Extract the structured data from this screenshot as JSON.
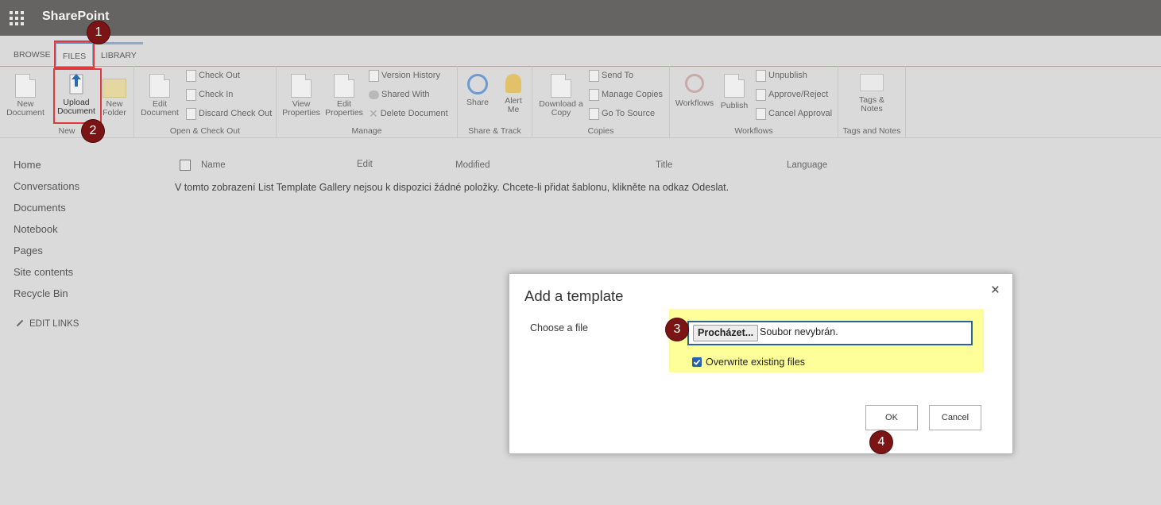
{
  "suite": {
    "brand": "SharePoint",
    "waffle_icon": "app-launcher-icon"
  },
  "ribbon": {
    "tabs": [
      {
        "label": "BROWSE"
      },
      {
        "label": "FILES"
      },
      {
        "label": "LIBRARY"
      }
    ],
    "groups": {
      "new": {
        "label": "New",
        "new_document": "New\nDocument",
        "upload_document": "Upload\nDocument",
        "new_folder": "New\nFolder"
      },
      "open_checkout": {
        "label": "Open & Check Out",
        "edit_document": "Edit\nDocument",
        "check_out": "Check Out",
        "check_in": "Check In",
        "discard_check_out": "Discard Check Out"
      },
      "manage": {
        "label": "Manage",
        "view_properties": "View\nProperties",
        "edit_properties": "Edit\nProperties",
        "version_history": "Version History",
        "shared_with": "Shared With",
        "delete_document": "Delete Document"
      },
      "share_track": {
        "label": "Share & Track",
        "share": "Share",
        "alert_me": "Alert\nMe"
      },
      "copies": {
        "label": "Copies",
        "download_copy": "Download a\nCopy",
        "send_to": "Send To",
        "manage_copies": "Manage Copies",
        "go_to_source": "Go To Source"
      },
      "workflows": {
        "label": "Workflows",
        "workflows": "Workflows",
        "publish": "Publish",
        "unpublish": "Unpublish",
        "approve_reject": "Approve/Reject",
        "cancel_approval": "Cancel Approval"
      },
      "tags_notes": {
        "label": "Tags and Notes",
        "tags_notes": "Tags &\nNotes"
      }
    }
  },
  "callouts": [
    "1",
    "2",
    "3",
    "4"
  ],
  "nav": {
    "items": [
      "Home",
      "Conversations",
      "Documents",
      "Notebook",
      "Pages",
      "Site contents",
      "Recycle Bin"
    ],
    "edit_links": "EDIT LINKS"
  },
  "list": {
    "columns": [
      "Name",
      "Edit",
      "Modified",
      "Title",
      "Language"
    ],
    "empty_message": "V tomto zobrazení List Template Gallery nejsou k dispozici žádné položky. Chcete-li přidat šablonu, klikněte na odkaz Odeslat."
  },
  "dialog": {
    "title": "Add a template",
    "close": "×",
    "choose_file_label": "Choose a file",
    "browse_button": "Procházet...",
    "no_file_text": "Soubor nevybrán.",
    "overwrite_label": "Overwrite existing files",
    "overwrite_checked": true,
    "ok": "OK",
    "cancel": "Cancel"
  },
  "colors": {
    "suitebar": "#666462",
    "highlight": "#ffff99",
    "callout": "#7b1515",
    "redbox": "#e0393e"
  }
}
